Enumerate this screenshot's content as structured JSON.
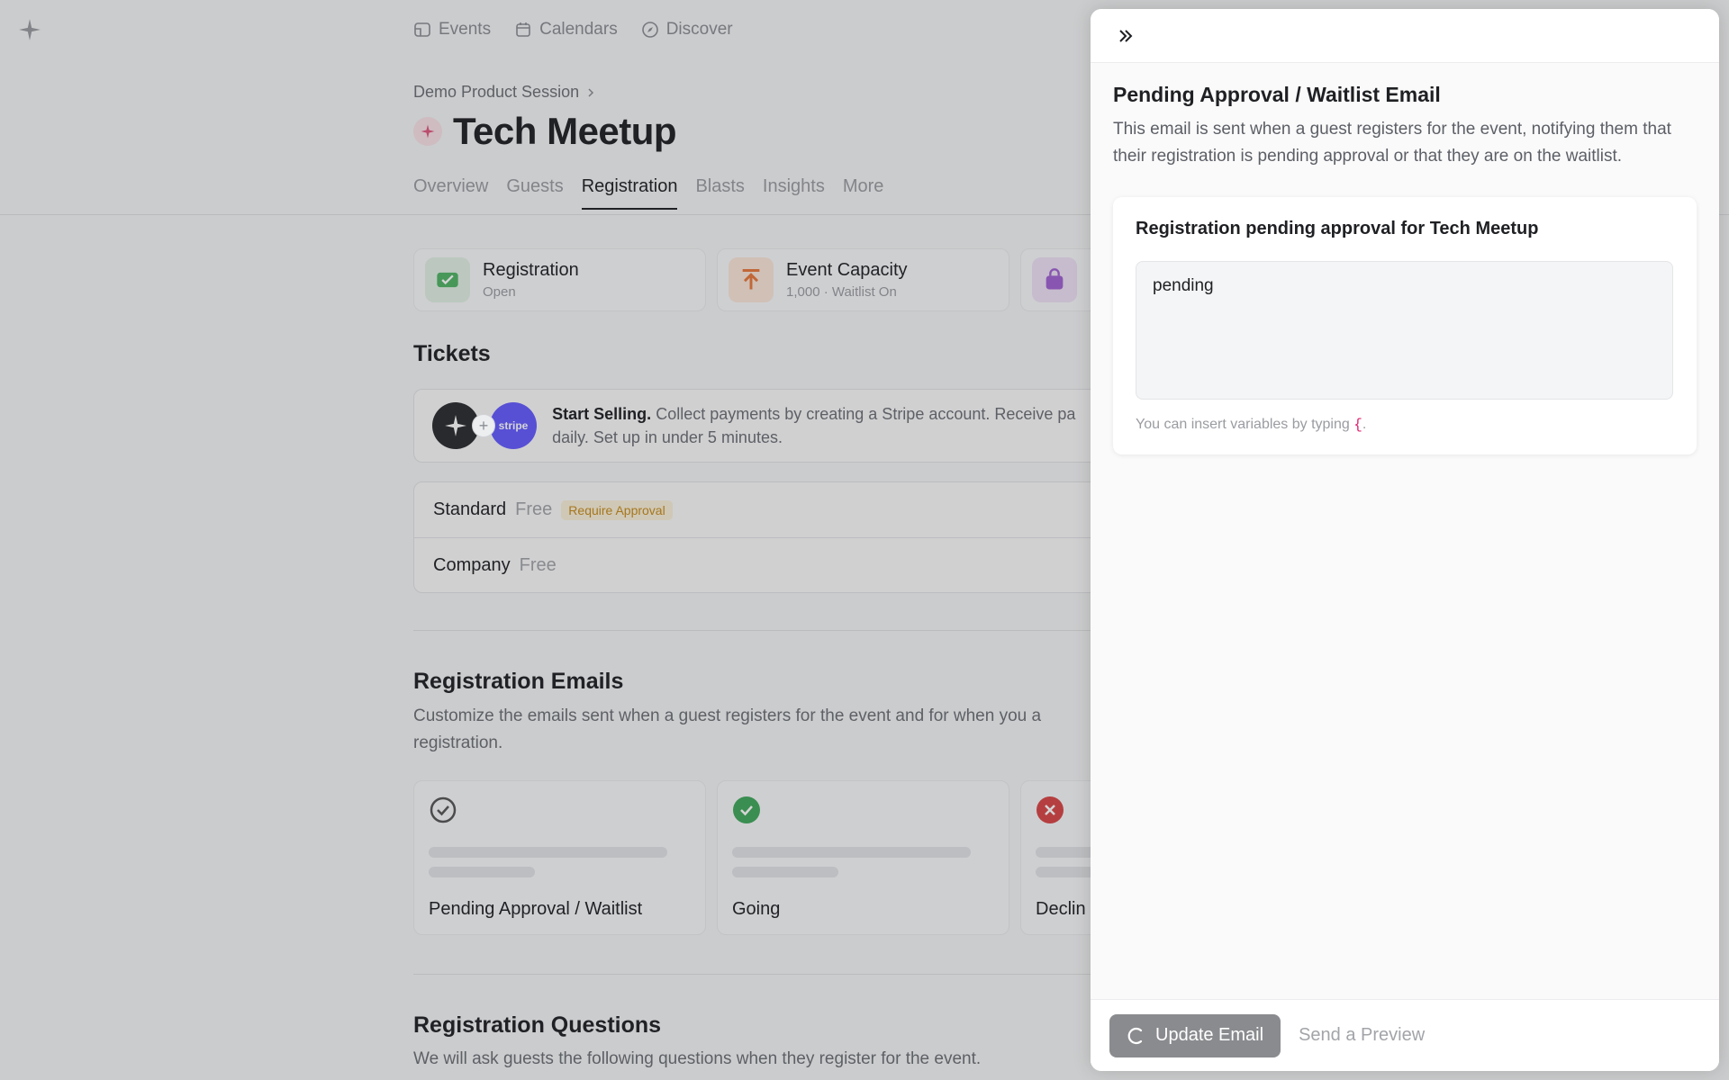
{
  "nav": {
    "items": [
      {
        "label": "Events",
        "icon": "ticket-icon"
      },
      {
        "label": "Calendars",
        "icon": "calendar-icon"
      },
      {
        "label": "Discover",
        "icon": "compass-icon"
      }
    ]
  },
  "event": {
    "breadcrumb": "Demo Product Session",
    "title": "Tech Meetup",
    "tabs": [
      "Overview",
      "Guests",
      "Registration",
      "Blasts",
      "Insights",
      "More"
    ],
    "active_tab": "Registration"
  },
  "stats": [
    {
      "title": "Registration",
      "sub": "Open",
      "icon": "ticket-check-icon",
      "color": "#4fb365"
    },
    {
      "title": "Event Capacity",
      "sub": "1,000 · Waitlist On",
      "icon": "arrow-up-icon",
      "color": "#e8773a"
    },
    {
      "title": "",
      "sub": "",
      "icon": "bag-icon",
      "color": "#a061d1"
    }
  ],
  "tickets": {
    "title": "Tickets",
    "stripe_bold": "Start Selling.",
    "stripe_text": " Collect payments by creating a Stripe account. Receive pa",
    "stripe_text_2": "daily. Set up in under 5 minutes.",
    "stripe_logo": "stripe",
    "rows": [
      {
        "name": "Standard",
        "price": "Free",
        "badge": "Require Approval"
      },
      {
        "name": "Company",
        "price": "Free",
        "badge": ""
      }
    ]
  },
  "reg_emails": {
    "title": "Registration Emails",
    "desc": "Customize the emails sent when a guest registers for the event and for when you a",
    "desc_2": "registration.",
    "cards": [
      {
        "label": "Pending Approval / Waitlist",
        "icon": "check-circle-outline-icon"
      },
      {
        "label": "Going",
        "icon": "check-circle-filled-icon"
      },
      {
        "label": "Declin",
        "icon": "x-circle-icon"
      }
    ]
  },
  "reg_questions": {
    "title": "Registration Questions",
    "desc": "We will ask guests the following questions when they register for the event."
  },
  "panel": {
    "title": "Pending Approval / Waitlist Email",
    "desc": "This email is sent when a guest registers for the event, notifying them that their registration is pending approval or that they are on the waitlist.",
    "subject": "Registration pending approval for Tech Meetup",
    "body": "pending",
    "hint_prefix": "You can insert variables by typing ",
    "hint_brace": "{",
    "hint_suffix": ".",
    "update_label": "Update Email",
    "preview_label": "Send a Preview"
  }
}
